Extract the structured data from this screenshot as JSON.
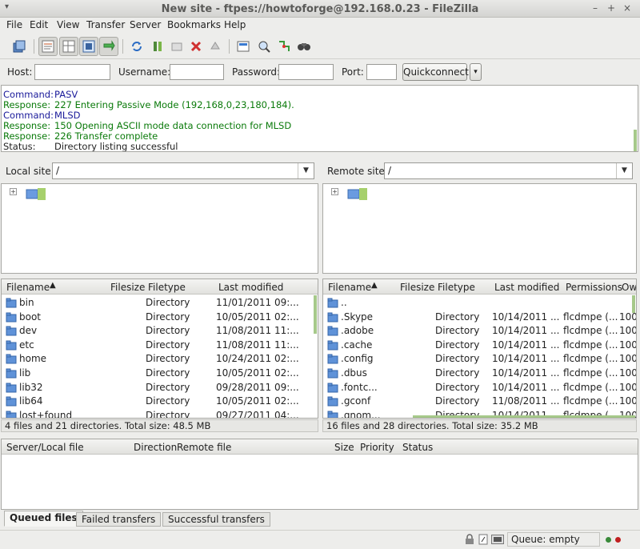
{
  "window": {
    "title": "New site - ftpes://howtoforge@192.168.0.23 - FileZilla",
    "controls": [
      "–",
      "+",
      "×"
    ]
  },
  "menu": [
    "File",
    "Edit",
    "View",
    "Transfer",
    "Server",
    "Bookmarks",
    "Help"
  ],
  "toolbar": {
    "icons": [
      "site-manager-icon",
      "toggle-log-icon",
      "toggle-local-tree-icon",
      "toggle-remote-tree-icon",
      "toggle-queue-icon",
      "refresh-icon",
      "process-queue-icon",
      "cancel-operation-icon",
      "disconnect-icon",
      "reconnect-icon",
      "filter-icon",
      "compare-icon",
      "sync-browse-icon",
      "search-icon"
    ]
  },
  "quickconnect": {
    "host_label": "Host:",
    "username_label": "Username:",
    "password_label": "Password:",
    "port_label": "Port:",
    "host_value": "",
    "username_value": "",
    "password_value": "",
    "port_value": "",
    "button_label": "Quickconnect"
  },
  "log": [
    {
      "kind": "Command:",
      "text": "PASV",
      "type": "cmd"
    },
    {
      "kind": "Response:",
      "text": "227 Entering Passive Mode (192,168,0,23,180,184).",
      "type": "resp"
    },
    {
      "kind": "Command:",
      "text": "MLSD",
      "type": "cmd"
    },
    {
      "kind": "Response:",
      "text": "150 Opening ASCII mode data connection for MLSD",
      "type": "resp"
    },
    {
      "kind": "Response:",
      "text": "226 Transfer complete",
      "type": "resp"
    },
    {
      "kind": "Status:",
      "text": "Directory listing successful",
      "type": "stat"
    }
  ],
  "local": {
    "site_label": "Local site:",
    "path": "/",
    "columns": [
      "Filename",
      "Filesize",
      "Filetype",
      "Last modified"
    ],
    "files": [
      {
        "name": "bin",
        "size": "",
        "type": "Directory",
        "modified": "11/01/2011 09:..."
      },
      {
        "name": "boot",
        "size": "",
        "type": "Directory",
        "modified": "10/05/2011 02:..."
      },
      {
        "name": "dev",
        "size": "",
        "type": "Directory",
        "modified": "11/08/2011 11:..."
      },
      {
        "name": "etc",
        "size": "",
        "type": "Directory",
        "modified": "11/08/2011 11:..."
      },
      {
        "name": "home",
        "size": "",
        "type": "Directory",
        "modified": "10/24/2011 02:..."
      },
      {
        "name": "lib",
        "size": "",
        "type": "Directory",
        "modified": "10/05/2011 02:..."
      },
      {
        "name": "lib32",
        "size": "",
        "type": "Directory",
        "modified": "09/28/2011 09:..."
      },
      {
        "name": "lib64",
        "size": "",
        "type": "Directory",
        "modified": "10/05/2011 02:..."
      },
      {
        "name": "lost+found",
        "size": "",
        "type": "Directory",
        "modified": "09/27/2011 04:..."
      }
    ],
    "summary": "4 files and 21 directories. Total size: 48.5 MB"
  },
  "remote": {
    "site_label": "Remote site:",
    "path": "/",
    "columns": [
      "Filename",
      "Filesize",
      "Filetype",
      "Last modified",
      "Permissions",
      "Ow"
    ],
    "files": [
      {
        "name": "..",
        "size": "",
        "type": "",
        "modified": "",
        "perms": "",
        "owner": ""
      },
      {
        "name": ".Skype",
        "size": "",
        "type": "Directory",
        "modified": "10/14/2011 ...",
        "perms": "flcdmpe (...",
        "owner": "100"
      },
      {
        "name": ".adobe",
        "size": "",
        "type": "Directory",
        "modified": "10/14/2011 ...",
        "perms": "flcdmpe (...",
        "owner": "100"
      },
      {
        "name": ".cache",
        "size": "",
        "type": "Directory",
        "modified": "10/14/2011 ...",
        "perms": "flcdmpe (...",
        "owner": "100"
      },
      {
        "name": ".config",
        "size": "",
        "type": "Directory",
        "modified": "10/14/2011 ...",
        "perms": "flcdmpe (...",
        "owner": "100"
      },
      {
        "name": ".dbus",
        "size": "",
        "type": "Directory",
        "modified": "10/14/2011 ...",
        "perms": "flcdmpe (...",
        "owner": "100"
      },
      {
        "name": ".fontc...",
        "size": "",
        "type": "Directory",
        "modified": "10/14/2011 ...",
        "perms": "flcdmpe (...",
        "owner": "100"
      },
      {
        "name": ".gconf",
        "size": "",
        "type": "Directory",
        "modified": "11/08/2011 ...",
        "perms": "flcdmpe (...",
        "owner": "100"
      },
      {
        "name": ".gnom...",
        "size": "",
        "type": "Directory",
        "modified": "10/14/2011 ...",
        "perms": "flcdmpe (...",
        "owner": "100"
      }
    ],
    "summary": "16 files and 28 directories. Total size: 35.2 MB"
  },
  "queue": {
    "columns": [
      "Server/Local file",
      "Direction",
      "Remote file",
      "Size",
      "Priority",
      "Status"
    ],
    "tabs": [
      "Queued files",
      "Failed transfers",
      "Successful transfers"
    ],
    "status": "Queue: empty"
  },
  "colors": {
    "command": "#1a1a9a",
    "response": "#0a7a0a",
    "folder": "#3c78c8",
    "accent_green": "#8bc34a"
  }
}
